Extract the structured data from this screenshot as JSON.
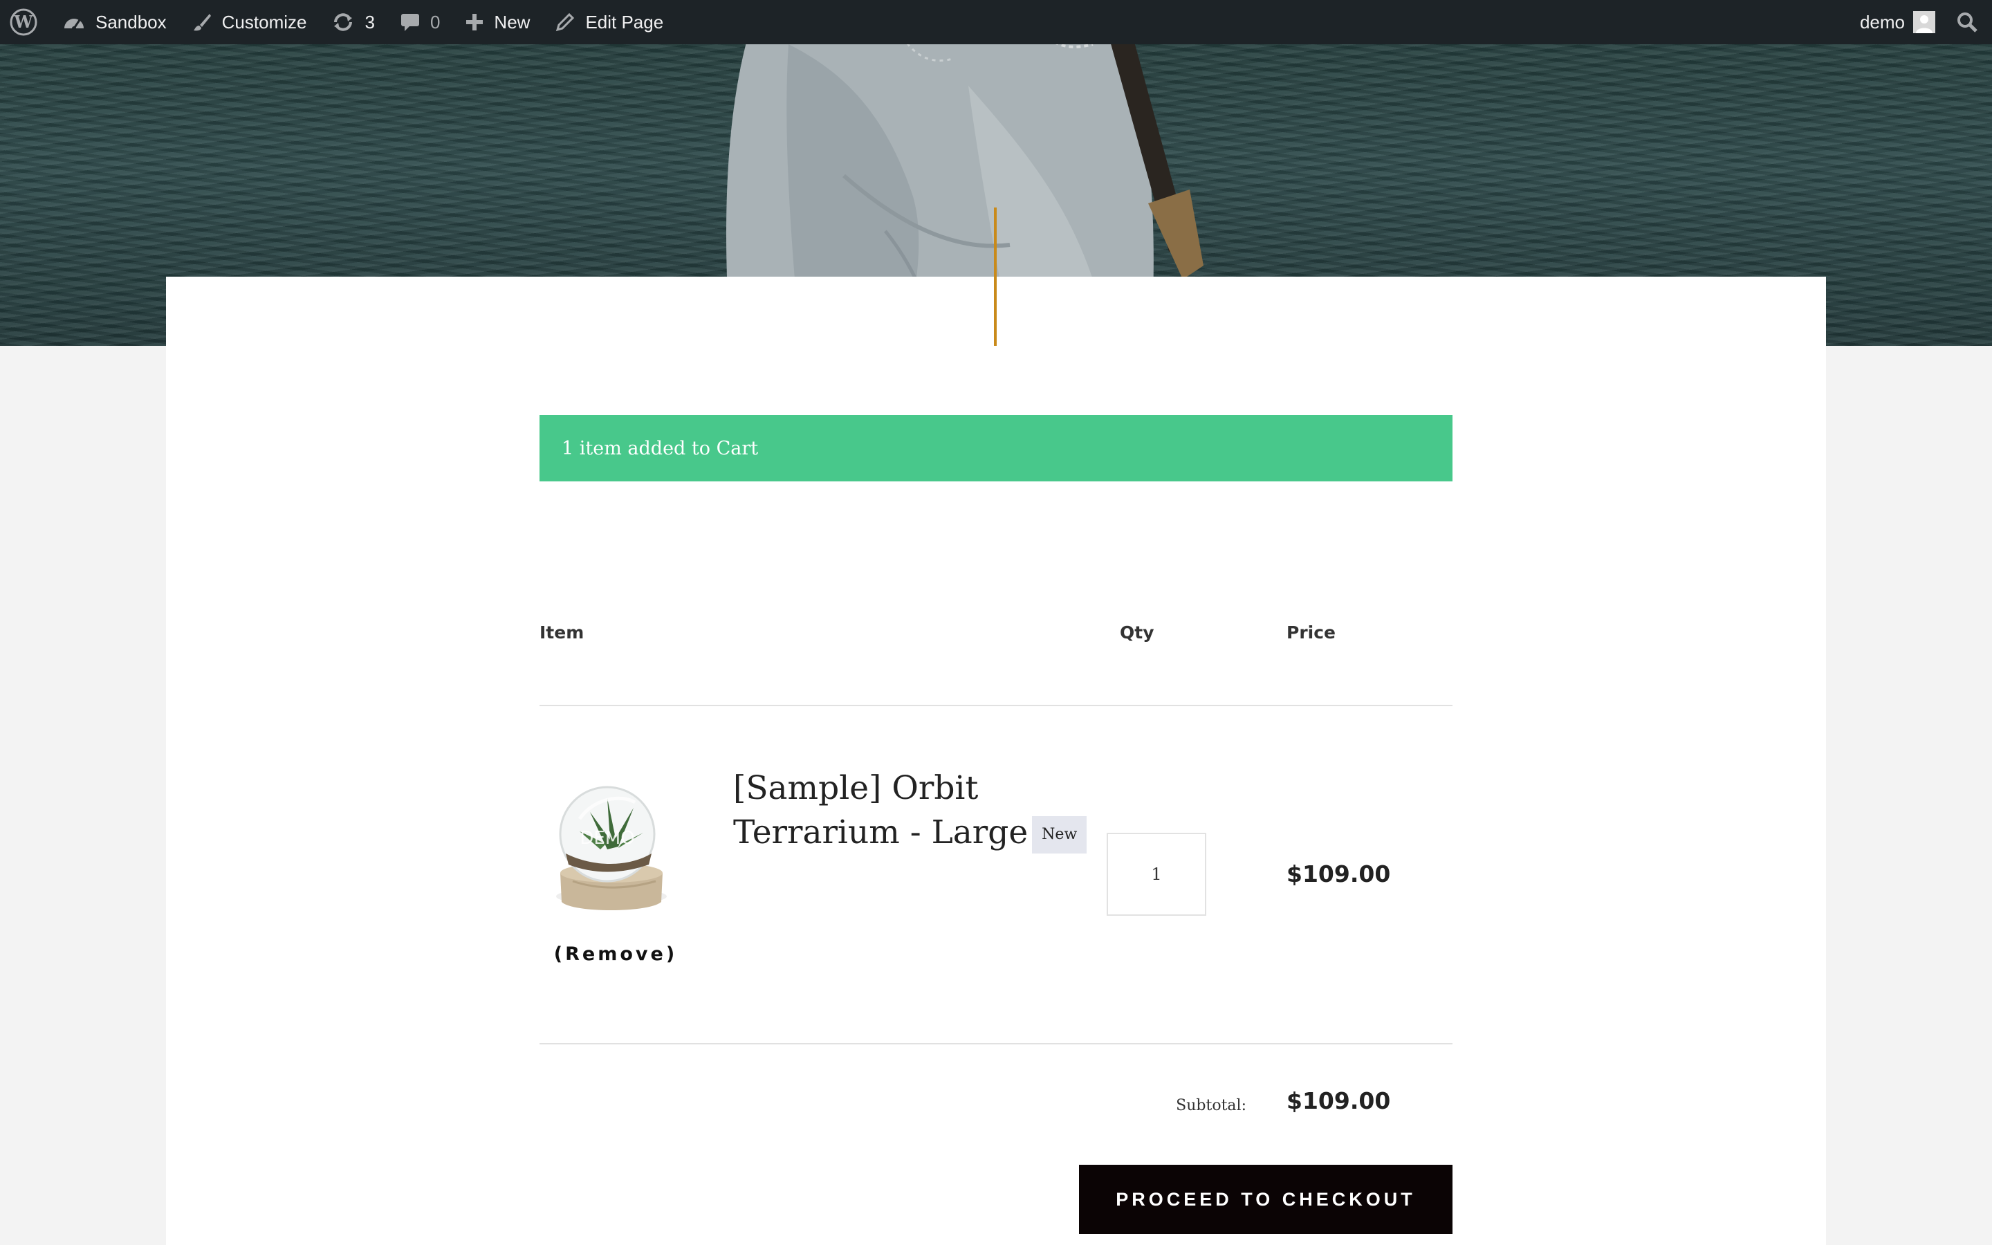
{
  "admin_bar": {
    "site_name": "Sandbox",
    "customize_label": "Customize",
    "updates_count": "3",
    "comments_count": "0",
    "new_label": "New",
    "edit_page_label": "Edit Page",
    "user_name": "demo"
  },
  "notice": {
    "message": "1 item added to Cart",
    "color": "#48c88b"
  },
  "cart": {
    "headers": {
      "item": "Item",
      "qty": "Qty",
      "price": "Price"
    },
    "items": [
      {
        "name": "[Sample] Orbit Terrarium - Large",
        "badge": "New",
        "thumbnail_watermark": "DEMO",
        "quantity": "1",
        "price": "$109.00",
        "remove_label": "(Remove)"
      }
    ],
    "subtotal_label": "Subtotal:",
    "subtotal_value": "$109.00",
    "checkout_label": "PROCEED TO CHECKOUT"
  },
  "colors": {
    "admin_bar_bg": "#1d2327",
    "accent_line": "#c98a1a",
    "checkout_bg": "#0b0405"
  }
}
